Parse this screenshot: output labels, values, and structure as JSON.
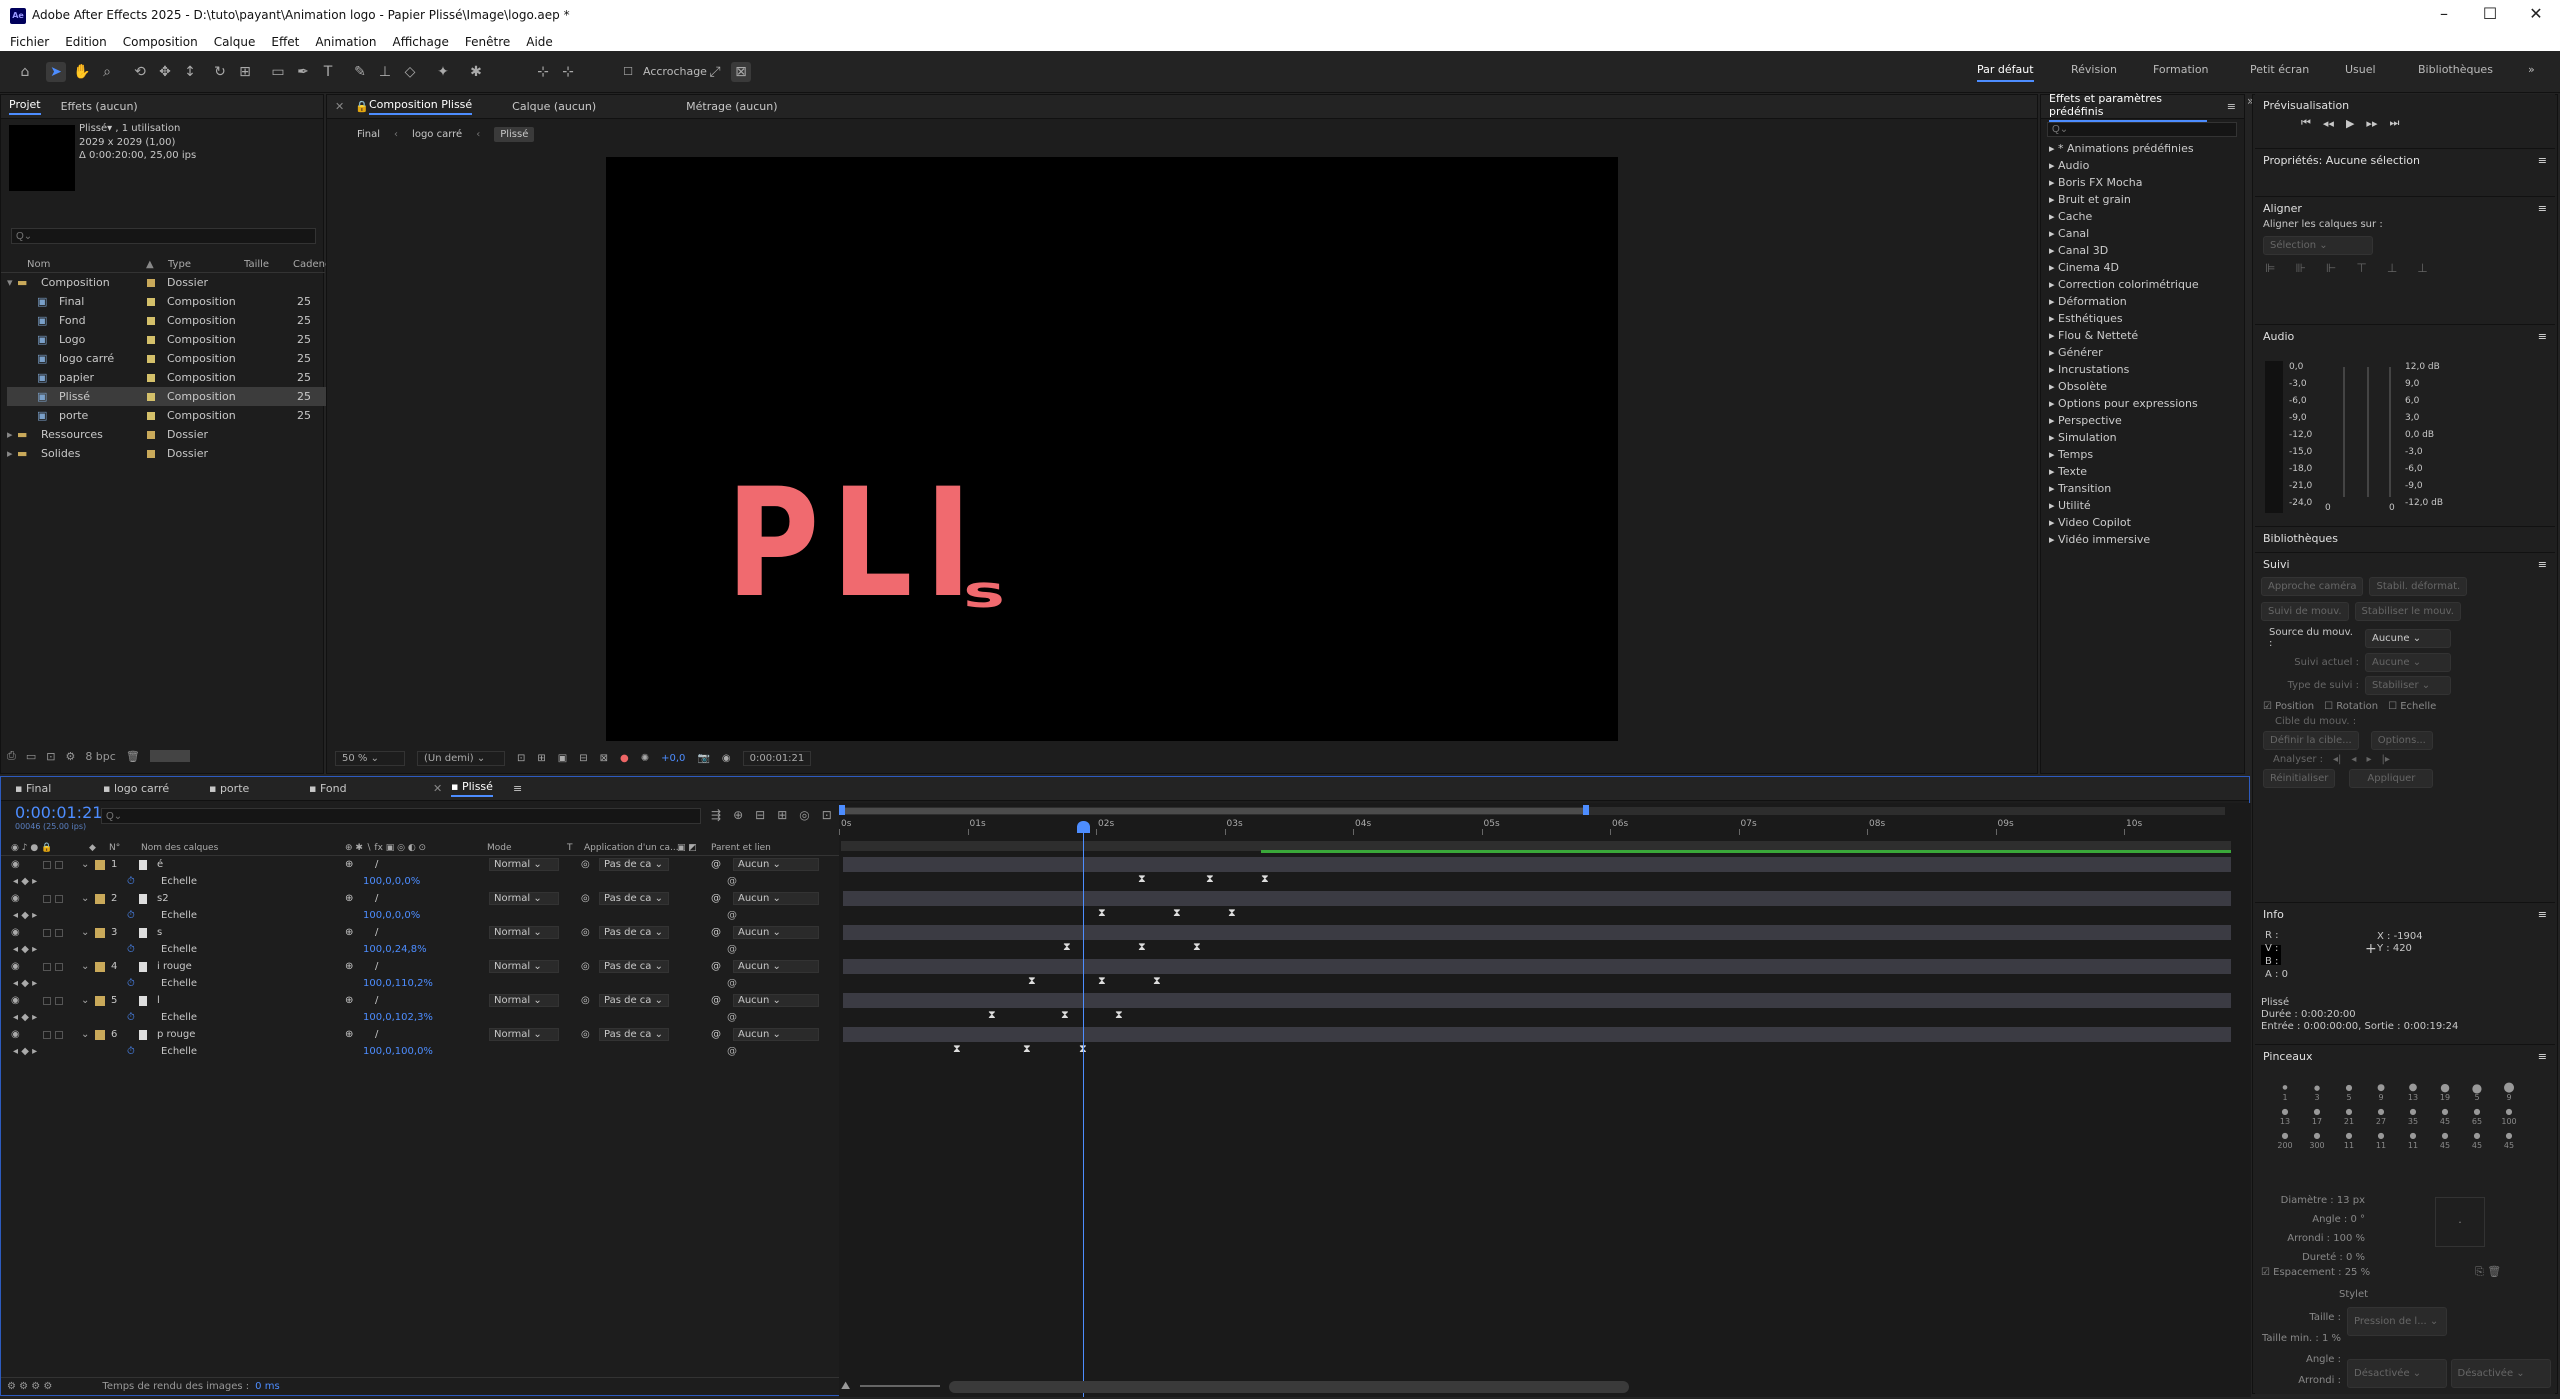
{
  "app": {
    "title": "Adobe After Effects 2025 - D:\\tuto\\payant\\Animation logo - Papier Plissé\\Image\\logo.aep *",
    "logo": "Ae"
  },
  "menu": [
    "Fichier",
    "Edition",
    "Composition",
    "Calque",
    "Effet",
    "Animation",
    "Affichage",
    "Fenêtre",
    "Aide"
  ],
  "toolbar": {
    "snap_label": "Accrochage"
  },
  "workspaces": [
    "Par défaut",
    "Révision",
    "Formation",
    "Petit écran",
    "Usuel",
    "Bibliothèques"
  ],
  "project": {
    "tabs": [
      "Projet",
      "Effets (aucun)"
    ],
    "selected_name": "Plissé▾ , 1 utilisation",
    "selected_dims": "2029 x 2029 (1,00)",
    "selected_duration": "Δ 0:00:20:00, 25,00 ips",
    "search_placeholder": "Q⌄",
    "columns": [
      "Nom",
      "Type",
      "Taille",
      "Cadenc"
    ],
    "items": [
      {
        "name": "Composition",
        "type": "Dossier",
        "rate": "",
        "folder": true
      },
      {
        "name": "Final",
        "type": "Composition",
        "rate": "25"
      },
      {
        "name": "Fond",
        "type": "Composition",
        "rate": "25"
      },
      {
        "name": "Logo",
        "type": "Composition",
        "rate": "25"
      },
      {
        "name": "logo carré",
        "type": "Composition",
        "rate": "25"
      },
      {
        "name": "papier",
        "type": "Composition",
        "rate": "25"
      },
      {
        "name": "Plissé",
        "type": "Composition",
        "rate": "25"
      },
      {
        "name": "porte",
        "type": "Composition",
        "rate": "25"
      },
      {
        "name": "Ressources",
        "type": "Dossier",
        "rate": "",
        "folder": true
      },
      {
        "name": "Solides",
        "type": "Dossier",
        "rate": "",
        "folder": true
      }
    ],
    "bpc": "8 bpc"
  },
  "comp": {
    "tabs": [
      "Composition Plissé",
      "Calque (aucun)",
      "Métrage (aucun)"
    ],
    "breadcrumbs": [
      "Final",
      "logo carré",
      "Plissé"
    ],
    "canvas_text": "PLI",
    "canvas_small": "s",
    "canvas_color": "#f06a6f",
    "zoom": "50 %",
    "resolution": "(Un demi)",
    "exposure": "+0,0",
    "timecode": "0:00:01:21"
  },
  "effects": {
    "title": "Effets et paramètres prédéfinis",
    "search_placeholder": "Q⌄",
    "items": [
      "* Animations prédéfinies",
      "Audio",
      "Boris FX Mocha",
      "Bruit et grain",
      "Cache",
      "Canal",
      "Canal 3D",
      "Cinema 4D",
      "Correction colorimétrique",
      "Déformation",
      "Esthétiques",
      "Flou & Netteté",
      "Générer",
      "Incrustations",
      "Obsolète",
      "Options pour expressions",
      "Perspective",
      "Simulation",
      "Temps",
      "Texte",
      "Transition",
      "Utilité",
      "Video Copilot",
      "Vidéo immersive"
    ]
  },
  "right": {
    "preview": "Prévisualisation",
    "props": "Propriétés: Aucune sélection",
    "align": "Aligner",
    "align_label": "Aligner les calques sur :",
    "align_value": "Sélection",
    "audio": "Audio",
    "audio_left": [
      "0,0",
      "-3,0",
      "-6,0",
      "-9,0",
      "-12,0",
      "-15,0",
      "-18,0",
      "-21,0",
      "-24,0"
    ],
    "audio_right": [
      "12,0 dB",
      "9,0",
      "6,0",
      "3,0",
      "0,0 dB",
      "-3,0",
      "-6,0",
      "-9,0",
      "-12,0 dB"
    ],
    "audio_zero": "0",
    "libraries": "Bibliothèques",
    "tracker": "Suivi",
    "tracker_buttons": [
      "Approche caméra",
      "Stabil. déformat.",
      "Suivi de mouv.",
      "Stabiliser le mouv."
    ],
    "source_label": "Source du mouv. :",
    "source_value": "Aucune",
    "current_label": "Suivi actuel :",
    "current_value": "Aucune",
    "type_label": "Type de suivi :",
    "type_value": "Stabiliser",
    "checks": [
      "Position",
      "Rotation",
      "Echelle"
    ],
    "target_label": "Cible du mouv. :",
    "target_btn": "Définir la cible...",
    "options_btn": "Options...",
    "analyze_label": "Analyser :",
    "reset_btn": "Réinitialiser",
    "apply_btn": "Appliquer",
    "info": "Info",
    "info_rgba": [
      "R :",
      "V :",
      "B :",
      "A : 0"
    ],
    "info_x": "X : -1904",
    "info_y": "Y : 420",
    "info_comp": "Plissé",
    "info_duration": "Durée : 0:00:20:00",
    "info_inout": "Entrée : 0:00:00:00, Sortie : 0:00:19:24",
    "brushes": "Pinceaux",
    "brush_sizes": [
      "1",
      "3",
      "5",
      "9",
      "13",
      "19",
      "5",
      "9",
      "13",
      "17",
      "21",
      "27",
      "35",
      "45",
      "65",
      "100",
      "200",
      "300",
      "11",
      "11",
      "11",
      "45",
      "45",
      "45"
    ],
    "diam": "Diamètre : 13 px",
    "angle": "Angle : 0 °",
    "round": "Arrondi : 100 %",
    "hard": "Dureté : 0 %",
    "spacing": "Espacement : 25 %",
    "stylet": "Stylet",
    "taille": "Taille :",
    "taille_val": "Pression de l...",
    "taille_min": "Taille min. : 1 %",
    "angle2": "Angle :",
    "angle2_val": "Désactivée",
    "arrondi2": "Arrondi :",
    "arrondi2_val": "Désactivée"
  },
  "timeline": {
    "tabs": [
      "Final",
      "logo carré",
      "porte",
      "Fond",
      "Plissé"
    ],
    "timecode": "0:00:01:21",
    "frames": "00046 (25.00 ips)",
    "search_placeholder": "Q⌄",
    "headers": {
      "num": "N°",
      "name": "Nom des calques",
      "mode": "Mode",
      "t": "T",
      "app": "Application d'un ca...",
      "parent": "Parent et lien"
    },
    "ruler": [
      "0s",
      "01s",
      "02s",
      "03s",
      "04s",
      "05s",
      "06s",
      "07s",
      "08s",
      "09s",
      "10s"
    ],
    "layers": [
      {
        "num": "1",
        "name": "é",
        "mode": "Normal",
        "app": "Pas de ca",
        "parent": "Aucun",
        "scale": "100,0,0,0%"
      },
      {
        "num": "2",
        "name": "s2",
        "mode": "Normal",
        "app": "Pas de ca",
        "parent": "Aucun",
        "scale": "100,0,0,0%"
      },
      {
        "num": "3",
        "name": "s",
        "mode": "Normal",
        "app": "Pas de ca",
        "parent": "Aucun",
        "scale": "100,0,24,8%"
      },
      {
        "num": "4",
        "name": "i rouge",
        "mode": "Normal",
        "app": "Pas de ca",
        "parent": "Aucun",
        "scale": "100,0,110,2%"
      },
      {
        "num": "5",
        "name": "l",
        "mode": "Normal",
        "app": "Pas de ca",
        "parent": "Aucun",
        "scale": "100,0,102,3%"
      },
      {
        "num": "6",
        "name": "p rouge",
        "mode": "Normal",
        "app": "Pas de ca",
        "parent": "Aucun",
        "scale": "100,0,100,0%"
      }
    ],
    "prop_name": "Echelle",
    "render_label": "Temps de rendu des images :",
    "render_value": "0 ms"
  }
}
